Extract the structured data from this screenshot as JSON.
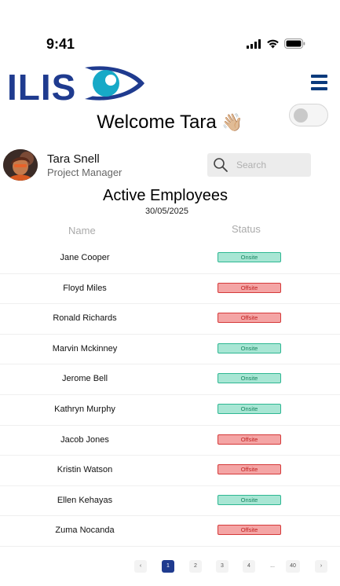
{
  "status_bar": {
    "time": "9:41"
  },
  "header": {
    "logo_text": "ILIS",
    "brand_color": "#1f3b8f",
    "accent_color": "#17a9c7"
  },
  "welcome": {
    "text": "Welcome Tara",
    "emoji": "👋🏼"
  },
  "user": {
    "name": "Tara Snell",
    "role": "Project Manager"
  },
  "search": {
    "placeholder": "Search"
  },
  "section": {
    "title": "Active Employees",
    "date": "30/05/2025"
  },
  "table": {
    "columns": [
      "Name",
      "Status"
    ],
    "rows": [
      {
        "name": "Jane Cooper",
        "status": "Onsite"
      },
      {
        "name": "Floyd Miles",
        "status": "Offsite"
      },
      {
        "name": "Ronald Richards",
        "status": "Offsite"
      },
      {
        "name": "Marvin Mckinney",
        "status": "Onsite"
      },
      {
        "name": "Jerome Bell",
        "status": "Onsite"
      },
      {
        "name": "Kathryn Murphy",
        "status": "Onsite"
      },
      {
        "name": "Jacob Jones",
        "status": "Offsite"
      },
      {
        "name": "Kristin Watson",
        "status": "Offsite"
      },
      {
        "name": "Ellen Kehayas",
        "status": "Onsite"
      },
      {
        "name": "Zuma Nocanda",
        "status": "Offsite"
      }
    ]
  },
  "pagination": {
    "prev": "‹",
    "pages": [
      "1",
      "2",
      "3",
      "4"
    ],
    "ellipsis": "...",
    "last": "40",
    "next": "›",
    "current": "1"
  }
}
